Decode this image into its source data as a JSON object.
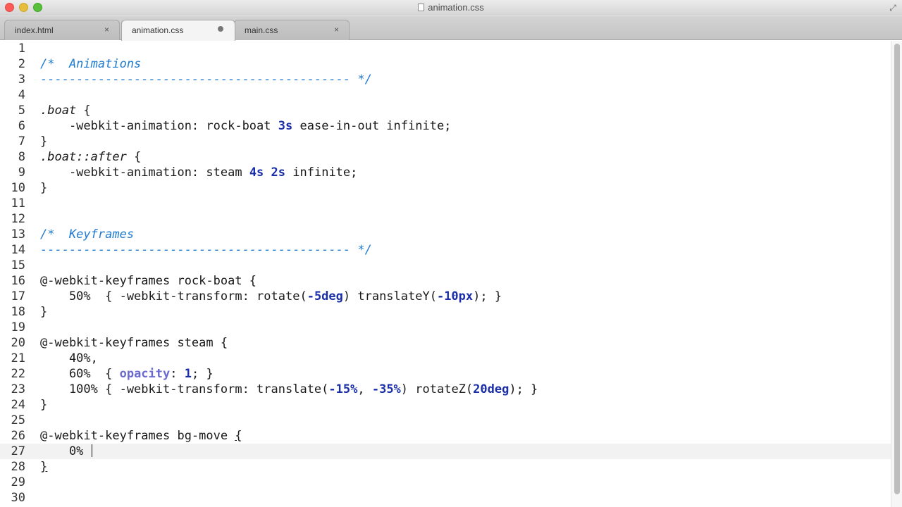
{
  "window": {
    "title": "animation.css"
  },
  "tabs": [
    {
      "label": "index.html",
      "close": "×"
    },
    {
      "label": "animation.css",
      "dirty": true
    },
    {
      "label": "main.css",
      "close": "×"
    }
  ],
  "editor": {
    "current_line": 27,
    "lines": [
      {
        "n": "1",
        "t": []
      },
      {
        "n": "2",
        "t": [
          [
            "cmt",
            "/*  Animations"
          ]
        ]
      },
      {
        "n": "3",
        "t": [
          [
            "cmt",
            "------------------------------------------- */"
          ]
        ]
      },
      {
        "n": "4",
        "t": []
      },
      {
        "n": "5",
        "t": [
          [
            "sel",
            ".boat"
          ],
          [
            "",
            " {"
          ]
        ]
      },
      {
        "n": "6",
        "t": [
          [
            "",
            "    -webkit-animation: rock-boat "
          ],
          [
            "num",
            "3s"
          ],
          [
            "",
            " ease-in-out infinite;"
          ]
        ]
      },
      {
        "n": "7",
        "t": [
          [
            "",
            "}"
          ]
        ]
      },
      {
        "n": "8",
        "t": [
          [
            "sel",
            ".boat::after"
          ],
          [
            "",
            " {"
          ]
        ]
      },
      {
        "n": "9",
        "t": [
          [
            "",
            "    -webkit-animation: steam "
          ],
          [
            "num",
            "4s"
          ],
          [
            "",
            " "
          ],
          [
            "num",
            "2s"
          ],
          [
            "",
            " infinite;"
          ]
        ]
      },
      {
        "n": "10",
        "t": [
          [
            "",
            "}"
          ]
        ]
      },
      {
        "n": "11",
        "t": []
      },
      {
        "n": "12",
        "t": []
      },
      {
        "n": "13",
        "t": [
          [
            "cmt",
            "/*  Keyframes"
          ]
        ]
      },
      {
        "n": "14",
        "t": [
          [
            "cmt",
            "------------------------------------------- */"
          ]
        ]
      },
      {
        "n": "15",
        "t": []
      },
      {
        "n": "16",
        "t": [
          [
            "",
            "@-webkit-keyframes rock-boat {"
          ]
        ]
      },
      {
        "n": "17",
        "t": [
          [
            "",
            "    50%  { -webkit-transform: rotate("
          ],
          [
            "num",
            "-5deg"
          ],
          [
            "",
            ") translateY("
          ],
          [
            "num",
            "-10px"
          ],
          [
            "",
            "); }"
          ]
        ]
      },
      {
        "n": "18",
        "t": [
          [
            "",
            "}"
          ]
        ]
      },
      {
        "n": "19",
        "t": []
      },
      {
        "n": "20",
        "t": [
          [
            "",
            "@-webkit-keyframes steam {"
          ]
        ]
      },
      {
        "n": "21",
        "t": [
          [
            "",
            "    40%,"
          ]
        ]
      },
      {
        "n": "22",
        "t": [
          [
            "",
            "    60%  { "
          ],
          [
            "kw",
            "opacity"
          ],
          [
            "",
            ": "
          ],
          [
            "num",
            "1"
          ],
          [
            "",
            "; }"
          ]
        ]
      },
      {
        "n": "23",
        "t": [
          [
            "",
            "    100% { -webkit-transform: translate("
          ],
          [
            "num",
            "-15%"
          ],
          [
            "",
            ", "
          ],
          [
            "num",
            "-35%"
          ],
          [
            "",
            ") rotateZ("
          ],
          [
            "num",
            "20deg"
          ],
          [
            "",
            "); }"
          ]
        ]
      },
      {
        "n": "24",
        "t": [
          [
            "",
            "}"
          ]
        ]
      },
      {
        "n": "25",
        "t": []
      },
      {
        "n": "26",
        "t": [
          [
            "",
            "@-webkit-keyframes bg-move "
          ],
          [
            "ul",
            "{"
          ]
        ]
      },
      {
        "n": "27",
        "t": [
          [
            "",
            "    0% "
          ]
        ],
        "caret": true
      },
      {
        "n": "28",
        "t": [
          [
            "ul",
            "}"
          ]
        ]
      },
      {
        "n": "29",
        "t": []
      },
      {
        "n": "30",
        "t": []
      }
    ]
  }
}
